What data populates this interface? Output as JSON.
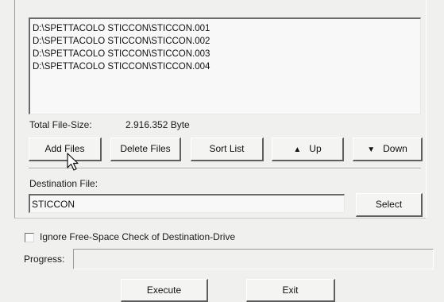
{
  "file_list": [
    "D:\\SPETTACOLO STICCON\\STICCON.001",
    "D:\\SPETTACOLO STICCON\\STICCON.002",
    "D:\\SPETTACOLO STICCON\\STICCON.003",
    "D:\\SPETTACOLO STICCON\\STICCON.004"
  ],
  "total_size": {
    "label": "Total File-Size:",
    "value": "2.916.352 Byte"
  },
  "buttons": {
    "add_files": "Add Files",
    "delete_files": "Delete Files",
    "sort_list": "Sort List",
    "up": "Up",
    "down": "Down",
    "select": "Select",
    "execute": "Execute",
    "exit": "Exit"
  },
  "icons": {
    "up": "arrow-up-icon",
    "down": "arrow-down-icon",
    "cursor": "mouse-pointer-icon"
  },
  "destination": {
    "label": "Destination File:",
    "value": "STICCON"
  },
  "ignore_check": {
    "label": "Ignore Free-Space Check of Destination-Drive",
    "checked": false
  },
  "progress": {
    "label": "Progress:",
    "value": 0
  }
}
